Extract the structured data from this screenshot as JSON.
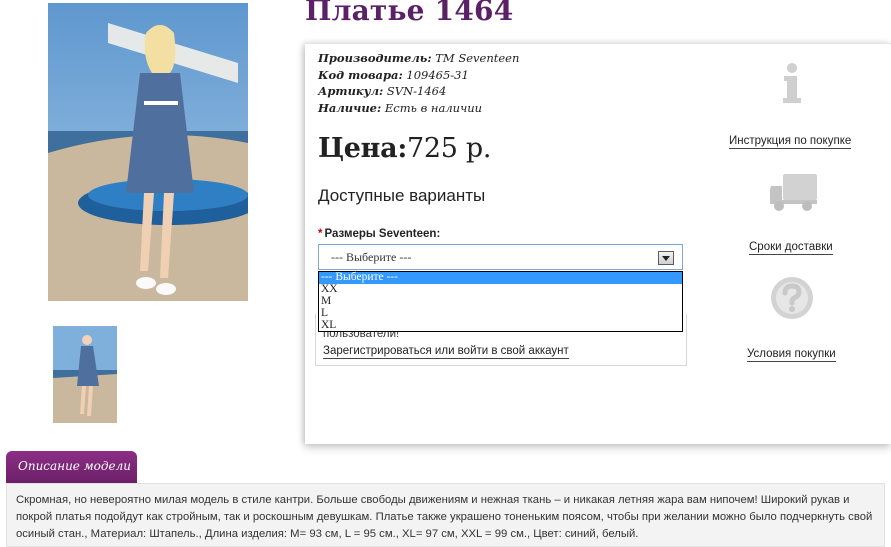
{
  "product": {
    "title": "Платье 1464",
    "specs": [
      {
        "label": "Производитель:",
        "value": "ТМ Seventeen"
      },
      {
        "label": "Код товара:",
        "value": "109465-31"
      },
      {
        "label": "Артикул:",
        "value": "SVN-1464"
      },
      {
        "label": "Наличие:",
        "value": "Есть в наличии"
      }
    ],
    "price_label": "Цена:",
    "price_value": "725 р.",
    "variants_heading": "Доступные варианты",
    "size_label": "Размеры Seventeen:",
    "size_required_mark": "*",
    "size_select": {
      "value": "--- Выберите ---",
      "options": [
        "--- Выберите ---",
        "XX",
        "M",
        "L",
        "XL"
      ]
    },
    "login_text": "пользователи!",
    "login_link": "Зарегистрироваться или войти в свой аккаунт"
  },
  "side_links": {
    "instructions": "Инструкция по покупке",
    "delivery": "Сроки доставки",
    "conditions": "Условия покупки"
  },
  "description": {
    "tab_label": "Описание модели",
    "text": "Скромная, но невероятно милая модель в стиле кантри. Больше свободы движениям и нежная ткань – и никакая летняя жара вам нипочем! Широкий рукав и покрой платья подойдут как стройным, так и роскошным девушкам. Платье также украшено тоненьким поясом, чтобы при желании можно было подчеркнуть свой осиный стан., Материал: Штапель., Длина изделия: М= 93 см, L = 95 см., XL= 97 см, XXL = 99 см., Цвет: синий, белый."
  },
  "icons": {
    "info": "info-icon",
    "truck": "truck-icon",
    "question": "question-icon"
  },
  "colors": {
    "title": "#5b2166",
    "tab": "#7a2675",
    "select_border": "#7ea6d8",
    "option_highlight": "#3399ff"
  }
}
